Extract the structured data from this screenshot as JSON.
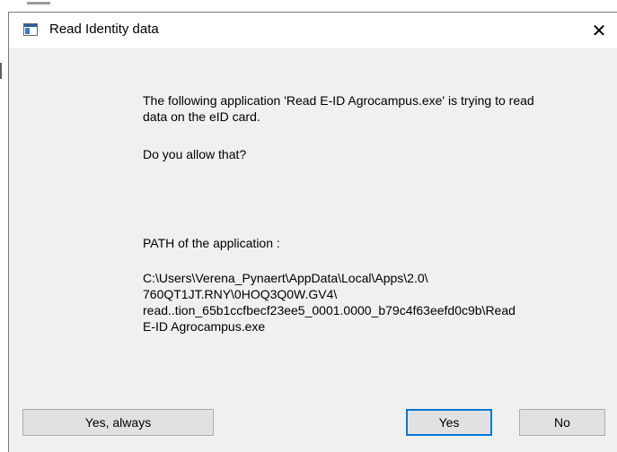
{
  "window": {
    "title": "Read Identity data",
    "close_glyph": "✕",
    "icon": "window-app-icon"
  },
  "message": {
    "line1": "The following application 'Read E-ID Agrocampus.exe' is trying to read",
    "line2": "data on the eID card.",
    "question": "Do you allow that?",
    "path_label": "PATH of the application :",
    "path_lines": [
      "C:\\Users\\Verena_Pynaert\\AppData\\Local\\Apps\\2.0\\",
      "760QT1JT.RNY\\0HOQ3Q0W.GV4\\",
      "read..tion_65b1ccfbecf23ee5_0001.0000_b79c4f63eefd0c9b\\Read",
      "E-ID Agrocampus.exe"
    ]
  },
  "buttons": {
    "yes_always": "Yes, always",
    "yes": "Yes",
    "no": "No"
  },
  "colors": {
    "default_button_border": "#0078d7",
    "dialog_background": "#f0f0f0"
  }
}
